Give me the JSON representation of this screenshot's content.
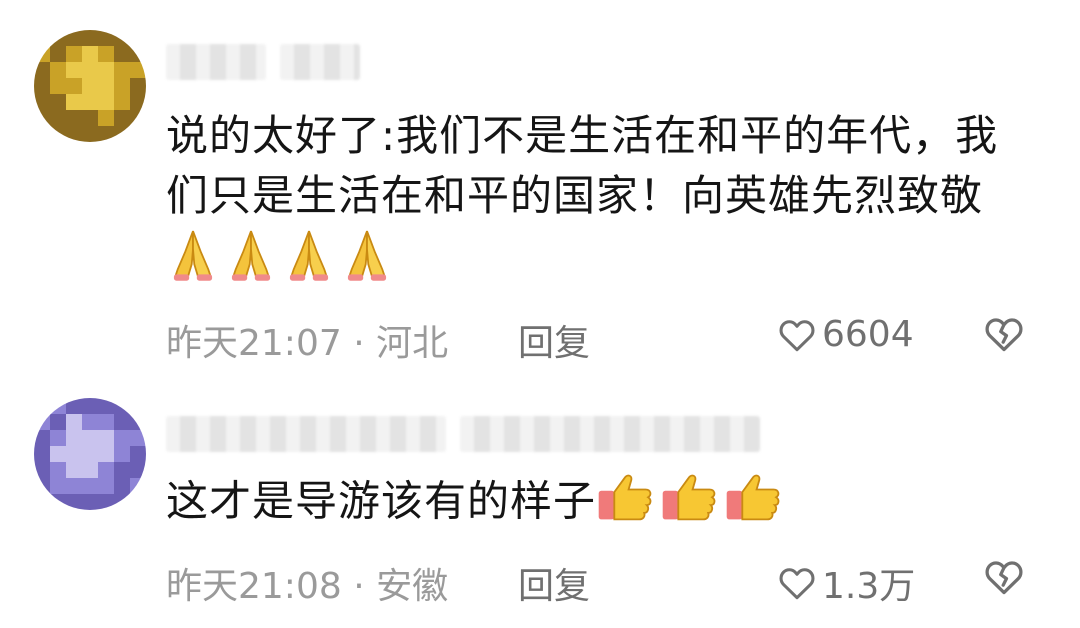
{
  "comments": [
    {
      "text": "说的太好了:我们不是生活在和平的年代，我们只是生活在和平的国家！向英雄先烈致敬",
      "emoji": "folded-hands",
      "emoji_count": 4,
      "time": "昨天21:07",
      "location": "河北",
      "time_location": "昨天21:07 · 河北",
      "reply_label": "回复",
      "likes": "6604",
      "avatar_colors": [
        "#8b6a1f",
        "#c9a227",
        "#e9c94a"
      ]
    },
    {
      "text": "这才是导游该有的样子",
      "emoji": "thumbs-up",
      "emoji_count": 3,
      "time": "昨天21:08",
      "location": "安徽",
      "time_location": "昨天21:08 · 安徽",
      "reply_label": "回复",
      "likes": "1.3万",
      "avatar_colors": [
        "#6b5fb5",
        "#8e84d6",
        "#c9c3ee"
      ]
    }
  ],
  "colors": {
    "meta_gray": "#9a9a9a",
    "text": "#151515",
    "icon_gray": "#707070"
  }
}
